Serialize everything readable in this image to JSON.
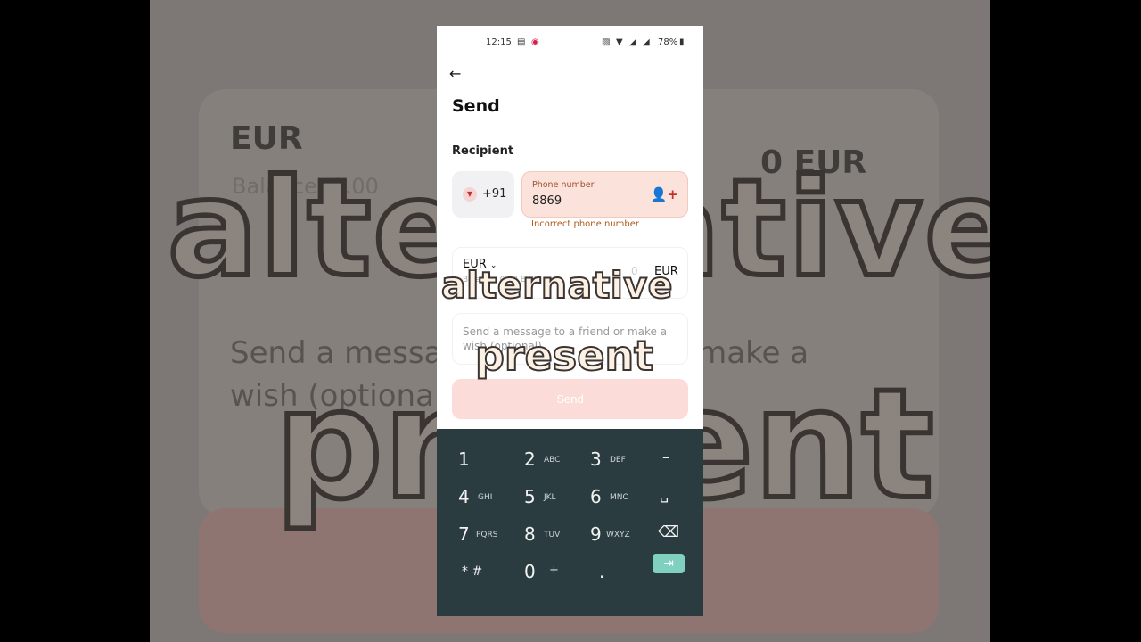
{
  "status_bar": {
    "time": "12:15",
    "battery": "78%"
  },
  "screen": {
    "title": "Send",
    "recipient_label": "Recipient",
    "country_code": "+91",
    "phone_label": "Phone number",
    "phone_value": "8869",
    "error": "Incorrect phone number",
    "currency": "EUR",
    "balance": "Balance: 0.00 EUR",
    "amount_zero": "0",
    "amount_currency": "EUR",
    "message_placeholder": "Send a message to a friend or make a wish (optional)",
    "send_label": "Send"
  },
  "caption": {
    "line1": "alternative",
    "line2": "present"
  },
  "keyboard": {
    "keys": [
      {
        "main": "1",
        "sub": ""
      },
      {
        "main": "2",
        "sub": "ABC"
      },
      {
        "main": "3",
        "sub": "DEF"
      },
      {
        "main": "–",
        "sub": ""
      },
      {
        "main": "4",
        "sub": "GHI"
      },
      {
        "main": "5",
        "sub": "JKL"
      },
      {
        "main": "6",
        "sub": "MNO"
      },
      {
        "main": "␣",
        "sub": ""
      },
      {
        "main": "7",
        "sub": "PQRS"
      },
      {
        "main": "8",
        "sub": "TUV"
      },
      {
        "main": "9",
        "sub": "WXYZ"
      },
      {
        "main": "⌫",
        "sub": ""
      },
      {
        "main": "* #",
        "sub": ""
      },
      {
        "main": "0",
        "sub": "+"
      },
      {
        "main": ".",
        "sub": ""
      }
    ],
    "tab_key": "⇥"
  },
  "background": {
    "currency": "EUR",
    "balance": "Balance: 0.00",
    "amount": "0 EUR",
    "message": "Send a message to a friend or make a wish (optional)",
    "caption1": "alternative",
    "caption2": "present"
  },
  "colors": {
    "accent": "#c0312b",
    "send_button_disabled": "#fbdcd8",
    "phone_field_error_bg": "#fbe2da",
    "keyboard_bg": "#2b3c40",
    "tab_key": "#7fd0bf"
  },
  "icons": [
    "back-arrow-icon",
    "chevron-down-icon",
    "add-contact-icon",
    "backspace-icon",
    "tab-icon"
  ]
}
